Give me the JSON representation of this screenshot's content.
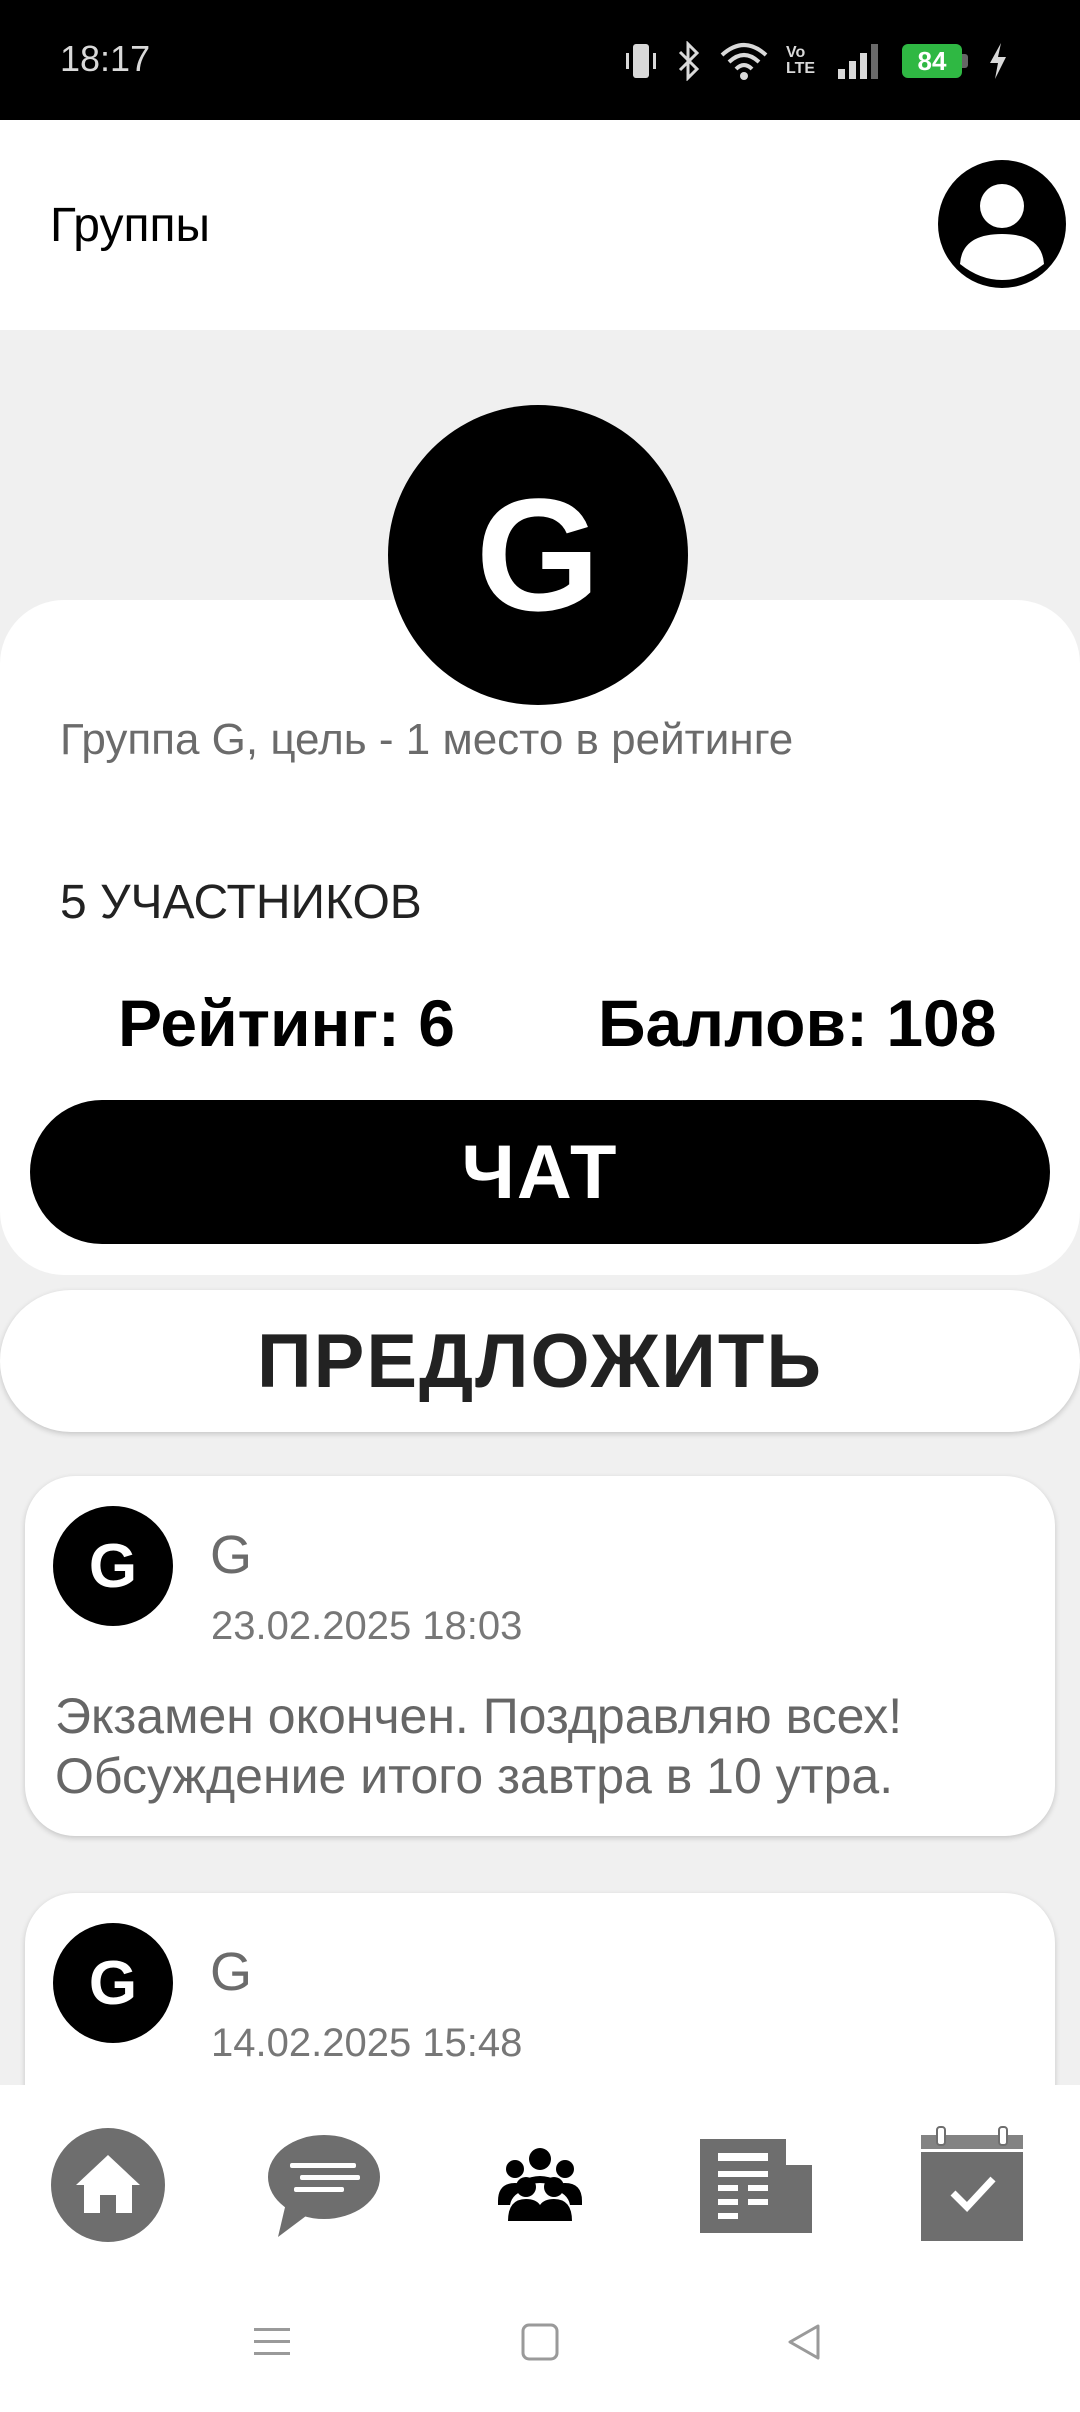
{
  "status_bar": {
    "time": "18:17",
    "battery_level": "84",
    "icons": [
      "vibrate-icon",
      "bluetooth-icon",
      "wifi-icon",
      "volte-icon",
      "signal-icon",
      "battery-icon",
      "charging-icon"
    ],
    "volte_label": "Vo LTE"
  },
  "app_bar": {
    "title": "Группы",
    "profile_icon": "profile-icon"
  },
  "group": {
    "avatar_letter": "G",
    "description": "Группа G, цель - 1 место в рейтинге",
    "members": "5 УЧАСТНИКОВ",
    "rating": "Рейтинг: 6",
    "points": "Баллов: 108",
    "chat_button": "ЧАТ",
    "propose_button": "ПРЕДЛОЖИТЬ"
  },
  "posts": [
    {
      "avatar_letter": "G",
      "author": "G",
      "date": "23.02.2025 18:03",
      "text": "Экзамен окончен. Поздравляю всех! Обсуждение итого завтра в 10 утра."
    },
    {
      "avatar_letter": "G",
      "author": "G",
      "date": "14.02.2025 15:48"
    }
  ],
  "bottom_nav": {
    "items": [
      "home-icon",
      "chat-icon",
      "groups-icon",
      "news-icon",
      "calendar-icon"
    ],
    "active": "groups-icon"
  },
  "colors": {
    "accent": "#000000",
    "background": "#f0f0f0",
    "card": "#ffffff",
    "inactive_icon": "#6e6e6e",
    "battery": "#2fb843"
  }
}
